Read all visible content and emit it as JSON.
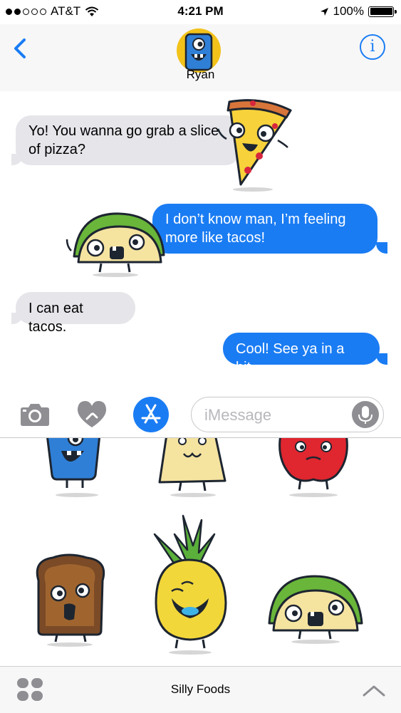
{
  "status_bar": {
    "carrier": "AT&T",
    "time": "4:21 PM",
    "battery": "100%",
    "battery_level": 1.0,
    "signal_bars_filled": 2,
    "signal_bars_total": 5
  },
  "nav": {
    "contact_name": "Ryan",
    "back_icon": "chevron-left-icon",
    "info_icon": "info-icon"
  },
  "messages": [
    {
      "direction": "incoming",
      "text_line1": "Yo! You wanna go grab a slice",
      "text_line2": "of pizza?"
    },
    {
      "direction": "outgoing",
      "text_line1": "I don’t know man, I’m feeling",
      "text_line2": "more like tacos!"
    },
    {
      "direction": "incoming",
      "text": "I can eat tacos."
    },
    {
      "direction": "outgoing",
      "text": "Cool! See ya in a bit."
    }
  ],
  "input": {
    "placeholder": "iMessage",
    "camera_icon": "camera-icon",
    "digital_touch_icon": "digital-touch-heart-icon",
    "app_store_icon": "app-store-icon",
    "mic_icon": "microphone-icon"
  },
  "drawer": {
    "app_name": "Silly Foods",
    "stickers": [
      "monster",
      "nacho",
      "apple",
      "toast",
      "pineapple",
      "taco"
    ]
  },
  "colors": {
    "accent": "#1a7cf3",
    "incoming_bubble": "#e5e5ea",
    "outgoing_bubble": "#1a7cf3"
  }
}
